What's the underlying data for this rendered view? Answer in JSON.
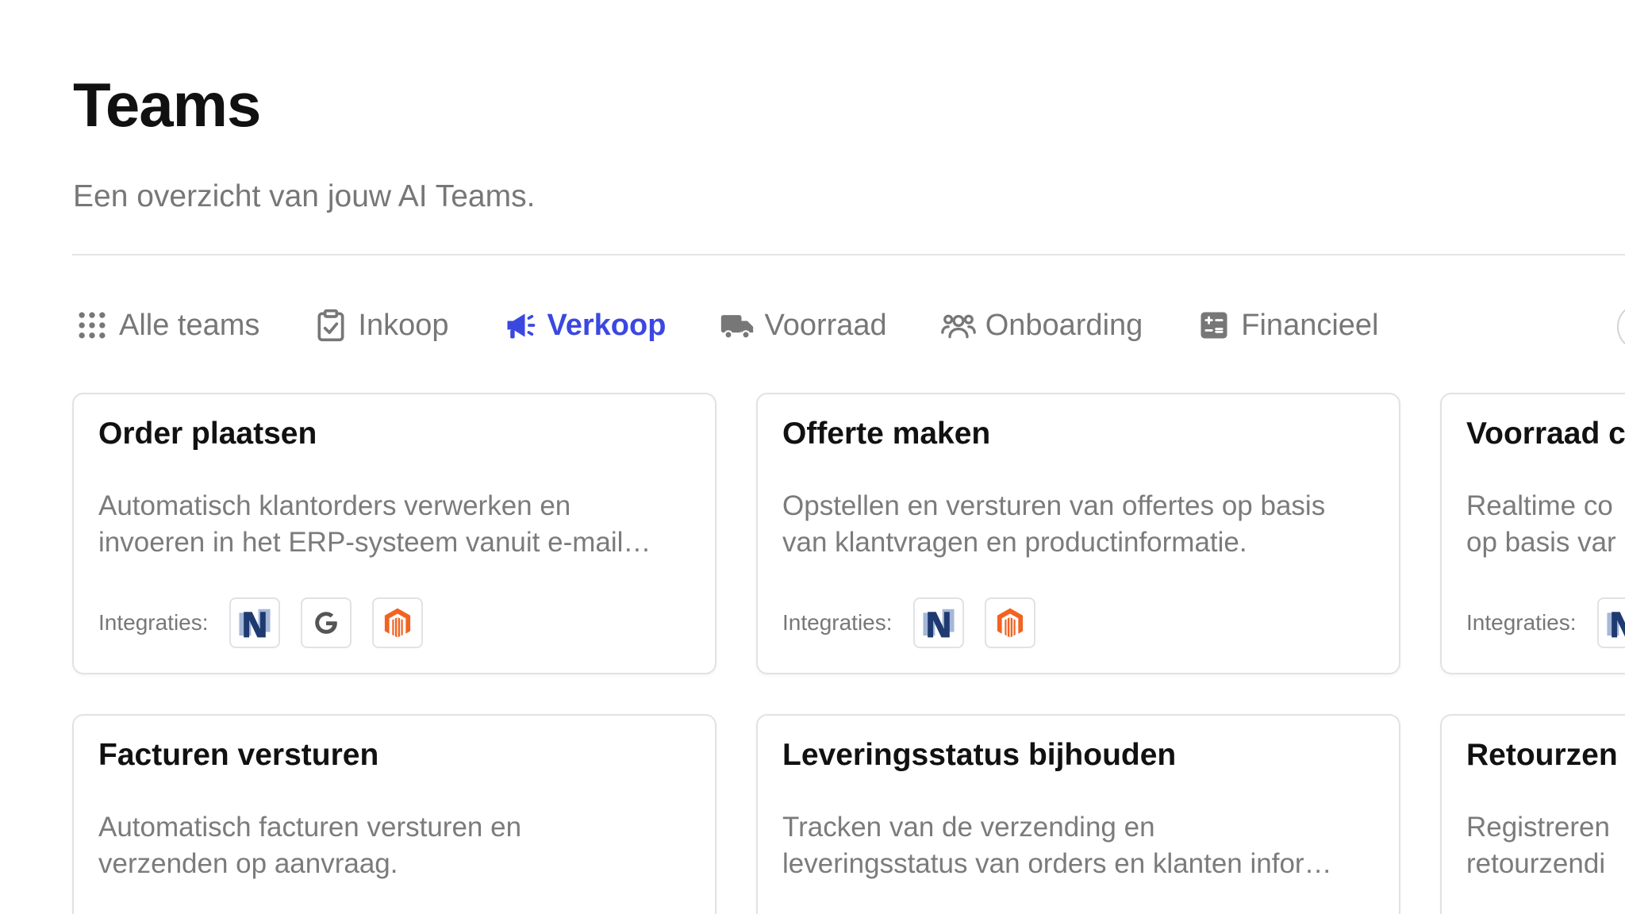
{
  "header": {
    "title": "Teams",
    "subtitle": "Een overzicht van jouw AI Teams."
  },
  "tabs": [
    {
      "label": "Alle teams",
      "icon": "grid-icon",
      "active": false
    },
    {
      "label": "Inkoop",
      "icon": "clipboard-check-icon",
      "active": false
    },
    {
      "label": "Verkoop",
      "icon": "megaphone-icon",
      "active": true
    },
    {
      "label": "Voorraad",
      "icon": "truck-icon",
      "active": false
    },
    {
      "label": "Onboarding",
      "icon": "users-icon",
      "active": false
    },
    {
      "label": "Financieel",
      "icon": "calculator-icon",
      "active": false
    }
  ],
  "cards": [
    {
      "title": "Order plaatsen",
      "desc_line1": "Automatisch klantorders verwerken en",
      "desc_line2": "invoeren in het ERP-systeem vanuit e-mail…",
      "integrations_label": "Integraties:",
      "integrations": [
        "netsuite-icon",
        "google-icon",
        "magento-icon"
      ]
    },
    {
      "title": "Offerte maken",
      "desc_line1": "Opstellen en versturen van offertes op basis",
      "desc_line2": "van klantvragen en productinformatie.",
      "integrations_label": "Integraties:",
      "integrations": [
        "netsuite-icon",
        "magento-icon"
      ]
    },
    {
      "title": "Voorraad c",
      "desc_line1": "Realtime co",
      "desc_line2": "op basis var",
      "integrations_label": "Integraties:",
      "integrations": [
        "netsuite-icon"
      ]
    },
    {
      "title": "Facturen versturen",
      "desc_line1": "Automatisch facturen versturen en",
      "desc_line2": "verzenden op aanvraag."
    },
    {
      "title": "Leveringsstatus bijhouden",
      "desc_line1": "Tracken van de verzending en",
      "desc_line2": "leveringsstatus van orders en klanten infor…"
    },
    {
      "title": "Retourzen",
      "desc_line1": "Registreren",
      "desc_line2": "retourzendi"
    }
  ],
  "colors": {
    "accent": "#3b48e0",
    "muted_text": "#777777",
    "netsuite_dark": "#1f3a70",
    "netsuite_light": "#a5b8d8",
    "magento_orange": "#f26322"
  }
}
